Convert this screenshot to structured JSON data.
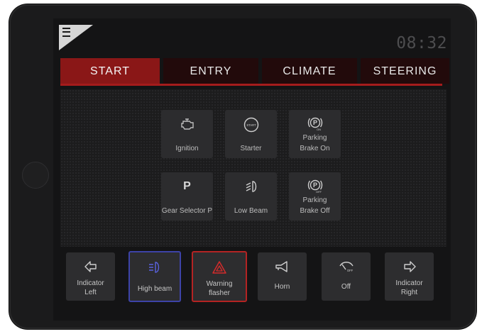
{
  "clock": "08:32",
  "tabs": [
    {
      "label": "START",
      "active": true
    },
    {
      "label": "ENTRY",
      "active": false
    },
    {
      "label": "CLIMATE",
      "active": false
    },
    {
      "label": "STEERING",
      "active": false
    }
  ],
  "tiles": {
    "ignition": {
      "label": "Ignition",
      "icon": "engine-icon"
    },
    "starter": {
      "label": "Starter",
      "icon": "start-button-icon",
      "icon_text": "START"
    },
    "parking_brake_on": {
      "label1": "Parking",
      "label2": "Brake On",
      "icon": "parking-brake-on-icon",
      "icon_text": "ON"
    },
    "gear_selector": {
      "label": "Gear Selector P",
      "icon_text": "P"
    },
    "low_beam": {
      "label": "Low Beam",
      "icon": "low-beam-icon"
    },
    "parking_brake_off": {
      "label1": "Parking",
      "label2": "Brake Off",
      "icon": "parking-brake-off-icon",
      "icon_text": "OFF"
    }
  },
  "bottom_buttons": {
    "indicator_left": {
      "label1": "Indicator",
      "label2": "Left",
      "icon": "arrow-left-icon"
    },
    "high_beam": {
      "label": "High beam",
      "icon": "high-beam-icon",
      "highlight": "#3d43a8"
    },
    "warning_flasher": {
      "label1": "Warning",
      "label2": "flasher",
      "icon": "hazard-icon",
      "highlight": "#b42323"
    },
    "horn": {
      "label": "Horn",
      "icon": "horn-icon"
    },
    "wiper": {
      "label": "Off",
      "icon": "wiper-icon",
      "icon_text": "OFF"
    },
    "indicator_right": {
      "label1": "Indicator",
      "label2": "Right",
      "icon": "arrow-right-icon"
    }
  },
  "colors": {
    "accent_red": "#a51c1c",
    "active_tab": "#8a1717",
    "high_beam_border": "#3d43a8",
    "hazard_border": "#b42323"
  }
}
